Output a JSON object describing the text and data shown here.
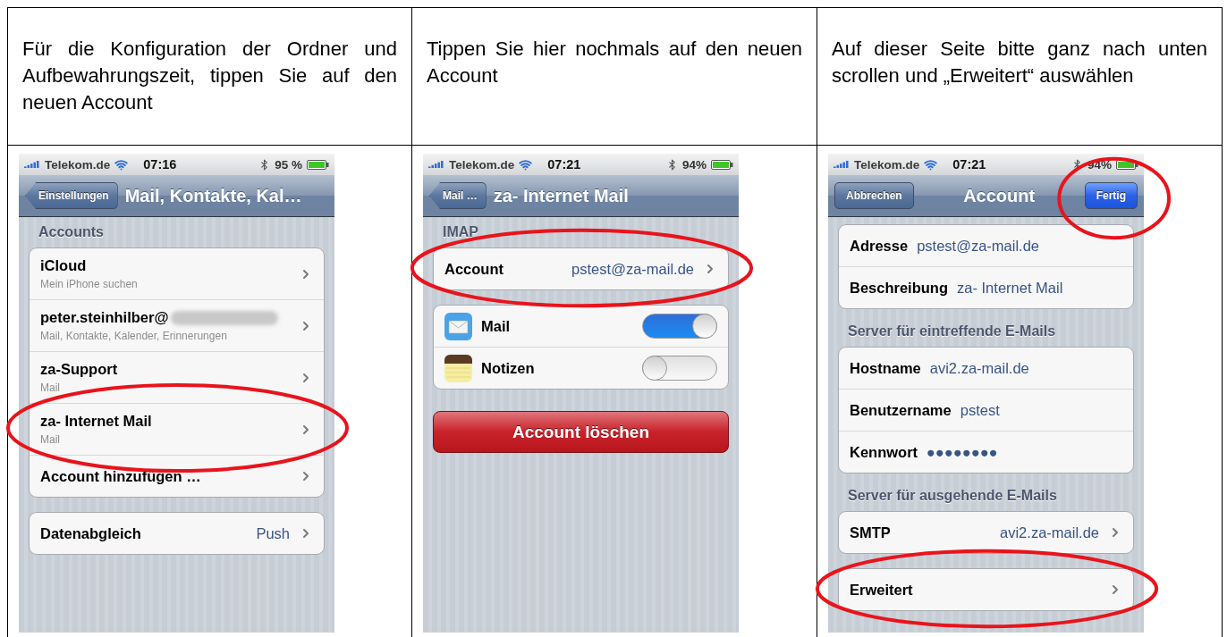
{
  "instructions": [
    "Für die Konfiguration der Ordner und Aufbewahrungszeit, tippen Sie auf den neuen Account",
    "Tippen Sie hier nochmals auf den neuen Account",
    "Auf dieser Seite bitte ganz nach unten scrollen und „Erweitert“ auswählen"
  ],
  "screens": [
    {
      "status_bar": {
        "carrier": "Telekom.de",
        "time": "07:16",
        "battery": "95 %"
      },
      "nav_bar": {
        "left_button": {
          "kind": "back",
          "label": "Einstellungen"
        },
        "title": "Mail, Kontakte, Kal…"
      },
      "sections": [
        {
          "kind": "group",
          "header": "Accounts",
          "rows": [
            {
              "kind": "nav",
              "label": "iCloud",
              "subtitle": "Mein iPhone suchen"
            },
            {
              "kind": "nav",
              "label": "peter.steinhilber@",
              "subtitle": "Mail, Kontakte, Kalender, Erinnerungen",
              "redacted": true
            },
            {
              "kind": "nav",
              "label": "za-Support",
              "subtitle": "Mail"
            },
            {
              "kind": "nav",
              "label": "za- Internet Mail",
              "subtitle": "Mail",
              "circled": true
            },
            {
              "kind": "nav",
              "label": "Account hinzufügen …"
            }
          ]
        },
        {
          "kind": "group",
          "rows": [
            {
              "kind": "nav",
              "label": "Datenabgleich",
              "value": "Push"
            }
          ]
        }
      ]
    },
    {
      "status_bar": {
        "carrier": "Telekom.de",
        "time": "07:21",
        "battery": "94%"
      },
      "nav_bar": {
        "left_button": {
          "kind": "back",
          "label": "Mail …"
        },
        "title": "za- Internet Mail"
      },
      "sections": [
        {
          "kind": "group",
          "header": "IMAP",
          "rows": [
            {
              "kind": "nav",
              "label": "Account",
              "value": "pstest@za-mail.de",
              "circled": true
            }
          ]
        },
        {
          "kind": "group",
          "rows": [
            {
              "kind": "mail_toggle",
              "label": "Mail",
              "on": true
            },
            {
              "kind": "notes_toggle",
              "label": "Notizen",
              "on": false
            }
          ]
        },
        {
          "kind": "button",
          "label": "Account löschen"
        }
      ]
    },
    {
      "status_bar": {
        "carrier": "Telekom.de",
        "time": "07:21",
        "battery": "94%"
      },
      "nav_bar": {
        "left_button": {
          "kind": "plain",
          "label": "Abbrechen"
        },
        "title": "Account",
        "right_button": {
          "kind": "done",
          "label": "Fertig",
          "circled": true
        }
      },
      "sections": [
        {
          "kind": "group",
          "rows": [
            {
              "kind": "field",
              "label": "Adresse",
              "value": "pstest@za-mail.de"
            },
            {
              "kind": "field",
              "label": "Beschreibung",
              "value": "za- Internet Mail"
            }
          ]
        },
        {
          "kind": "group",
          "header": "Server für eintreffende E-Mails",
          "rows": [
            {
              "kind": "field",
              "label": "Hostname",
              "value": "avi2.za-mail.de"
            },
            {
              "kind": "field",
              "label": "Benutzername",
              "value": "pstest"
            },
            {
              "kind": "field",
              "label": "Kennwort",
              "value": "●●●●●●●●"
            }
          ]
        },
        {
          "kind": "group",
          "header": "Server für ausgehende E-Mails",
          "rows": [
            {
              "kind": "nav",
              "label": "SMTP",
              "value": "avi2.za-mail.de"
            }
          ]
        },
        {
          "kind": "group",
          "rows": [
            {
              "kind": "nav",
              "label": "Erweitert",
              "circled": true
            }
          ]
        }
      ]
    }
  ]
}
